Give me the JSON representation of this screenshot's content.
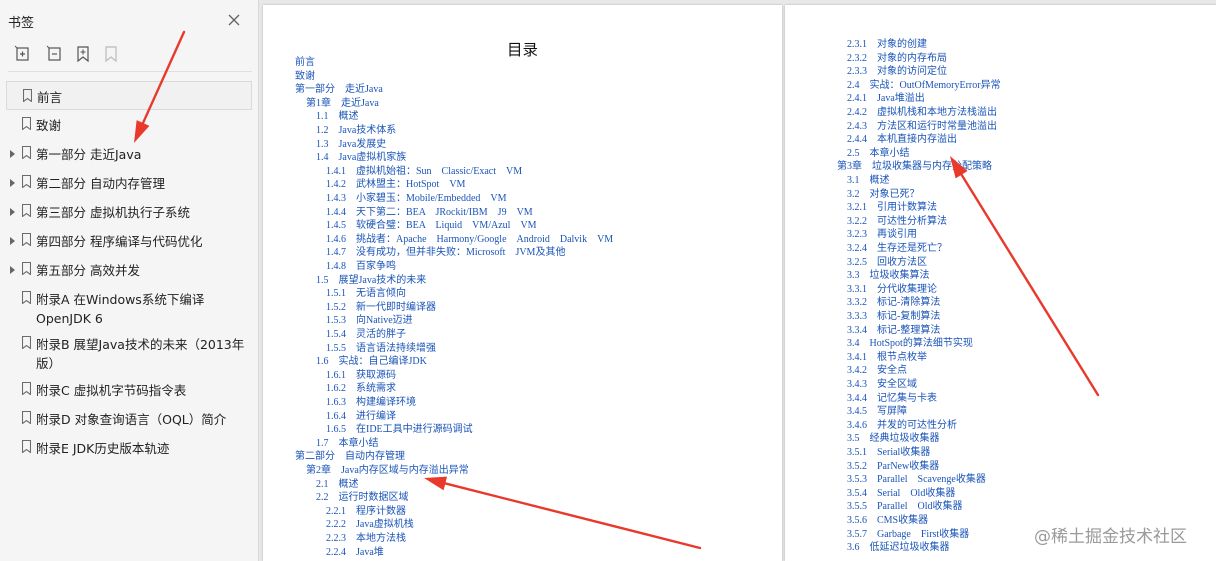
{
  "sidebar": {
    "title": "书签",
    "close_icon": "close-icon",
    "tools": [
      {
        "icon": "expand-bookmark-icon",
        "disabled": false
      },
      {
        "icon": "collapse-bookmark-icon",
        "disabled": false
      },
      {
        "icon": "add-bookmark-icon",
        "disabled": false
      },
      {
        "icon": "bookmark-flag-icon",
        "disabled": true
      }
    ],
    "items": [
      {
        "label": "前言",
        "expandable": false,
        "selected": true
      },
      {
        "label": "致谢",
        "expandable": false
      },
      {
        "label": "第一部分 走近Java",
        "expandable": true
      },
      {
        "label": "第二部分 自动内存管理",
        "expandable": true
      },
      {
        "label": "第三部分 虚拟机执行子系统",
        "expandable": true
      },
      {
        "label": "第四部分 程序编译与代码优化",
        "expandable": true
      },
      {
        "label": "第五部分 高效并发",
        "expandable": true
      },
      {
        "label": "附录A 在Windows系统下编译OpenJDK 6",
        "expandable": false,
        "lines": 2
      },
      {
        "label": "附录B 展望Java技术的未来（2013年版）",
        "expandable": false,
        "lines": 2
      },
      {
        "label": "附录C 虚拟机字节码指令表",
        "expandable": false
      },
      {
        "label": "附录D 对象查询语言（OQL）简介",
        "expandable": false
      },
      {
        "label": "附录E JDK历史版本轨迹",
        "expandable": false
      }
    ]
  },
  "page1": {
    "title": "目录",
    "entries": [
      {
        "text": "前言",
        "level": 0
      },
      {
        "text": "致谢",
        "level": 0
      },
      {
        "text": "第一部分　走近Java",
        "level": 0
      },
      {
        "text": "第1章　走近Java",
        "level": 1
      },
      {
        "text": "1.1　概述",
        "level": 2
      },
      {
        "text": "1.2　Java技术体系",
        "level": 2
      },
      {
        "text": "1.3　Java发展史",
        "level": 2
      },
      {
        "text": "1.4　Java虚拟机家族",
        "level": 2
      },
      {
        "text": "1.4.1　虚拟机始祖：Sun　Classic/Exact　VM",
        "level": 3
      },
      {
        "text": "1.4.2　武林盟主：HotSpot　VM",
        "level": 3
      },
      {
        "text": "1.4.3　小家碧玉：Mobile/Embedded　VM",
        "level": 3
      },
      {
        "text": "1.4.4　天下第二：BEA　JRockit/IBM　J9　VM",
        "level": 3
      },
      {
        "text": "1.4.5　软硬合璧：BEA　Liquid　VM/Azul　VM",
        "level": 3
      },
      {
        "text": "1.4.6　挑战者：Apache　Harmony/Google　Android　Dalvik　VM",
        "level": 3
      },
      {
        "text": "1.4.7　没有成功，但并非失败：Microsoft　JVM及其他",
        "level": 3
      },
      {
        "text": "1.4.8　百家争鸣",
        "level": 3
      },
      {
        "text": "1.5　展望Java技术的未来",
        "level": 2
      },
      {
        "text": "1.5.1　无语言倾向",
        "level": 3
      },
      {
        "text": "1.5.2　新一代即时编译器",
        "level": 3
      },
      {
        "text": "1.5.3　向Native迈进",
        "level": 3
      },
      {
        "text": "1.5.4　灵活的胖子",
        "level": 3
      },
      {
        "text": "1.5.5　语言语法持续增强",
        "level": 3
      },
      {
        "text": "1.6　实战：自己编译JDK",
        "level": 2
      },
      {
        "text": "1.6.1　获取源码",
        "level": 3
      },
      {
        "text": "1.6.2　系统需求",
        "level": 3
      },
      {
        "text": "1.6.3　构建编译环境",
        "level": 3
      },
      {
        "text": "1.6.4　进行编译",
        "level": 3
      },
      {
        "text": "1.6.5　在IDE工具中进行源码调试",
        "level": 3
      },
      {
        "text": "1.7　本章小结",
        "level": 2
      },
      {
        "text": "第二部分　自动内存管理",
        "level": 0
      },
      {
        "text": "第2章　Java内存区域与内存溢出异常",
        "level": 1
      },
      {
        "text": "2.1　概述",
        "level": 2
      },
      {
        "text": "2.2　运行时数据区域",
        "level": 2
      },
      {
        "text": "2.2.1　程序计数器",
        "level": 3
      },
      {
        "text": "2.2.2　Java虚拟机栈",
        "level": 3
      },
      {
        "text": "2.2.3　本地方法栈",
        "level": 3
      },
      {
        "text": "2.2.4　Java堆",
        "level": 3
      }
    ]
  },
  "page2": {
    "entries": [
      {
        "text": "2.3.1　对象的创建",
        "level": 3
      },
      {
        "text": "2.3.2　对象的内存布局",
        "level": 3
      },
      {
        "text": "2.3.3　对象的访问定位",
        "level": 3
      },
      {
        "text": "2.4　实战：OutOfMemoryError异常",
        "level": 2
      },
      {
        "text": "2.4.1　Java堆溢出",
        "level": 3
      },
      {
        "text": "2.4.2　虚拟机栈和本地方法栈溢出",
        "level": 3
      },
      {
        "text": "2.4.3　方法区和运行时常量池溢出",
        "level": 3
      },
      {
        "text": "2.4.4　本机直接内存溢出",
        "level": 3
      },
      {
        "text": "2.5　本章小结",
        "level": 2
      },
      {
        "text": "第3章　垃圾收集器与内存分配策略",
        "level": 1
      },
      {
        "text": "3.1　概述",
        "level": 2
      },
      {
        "text": "3.2　对象已死？",
        "level": 2
      },
      {
        "text": "3.2.1　引用计数算法",
        "level": 3
      },
      {
        "text": "3.2.2　可达性分析算法",
        "level": 3
      },
      {
        "text": "3.2.3　再谈引用",
        "level": 3
      },
      {
        "text": "3.2.4　生存还是死亡？",
        "level": 3
      },
      {
        "text": "3.2.5　回收方法区",
        "level": 3
      },
      {
        "text": "3.3　垃圾收集算法",
        "level": 2
      },
      {
        "text": "3.3.1　分代收集理论",
        "level": 3
      },
      {
        "text": "3.3.2　标记-清除算法",
        "level": 3
      },
      {
        "text": "3.3.3　标记-复制算法",
        "level": 3
      },
      {
        "text": "3.3.4　标记-整理算法",
        "level": 3
      },
      {
        "text": "3.4　HotSpot的算法细节实现",
        "level": 2
      },
      {
        "text": "3.4.1　根节点枚举",
        "level": 3
      },
      {
        "text": "3.4.2　安全点",
        "level": 3
      },
      {
        "text": "3.4.3　安全区域",
        "level": 3
      },
      {
        "text": "3.4.4　记忆集与卡表",
        "level": 3
      },
      {
        "text": "3.4.5　写屏障",
        "level": 3
      },
      {
        "text": "3.4.6　并发的可达性分析",
        "level": 3
      },
      {
        "text": "3.5　经典垃圾收集器",
        "level": 2
      },
      {
        "text": "3.5.1　Serial收集器",
        "level": 3
      },
      {
        "text": "3.5.2　ParNew收集器",
        "level": 3
      },
      {
        "text": "3.5.3　Parallel　Scavenge收集器",
        "level": 3
      },
      {
        "text": "3.5.4　Serial　Old收集器",
        "level": 3
      },
      {
        "text": "3.5.5　Parallel　Old收集器",
        "level": 3
      },
      {
        "text": "3.5.6　CMS收集器",
        "level": 3
      },
      {
        "text": "3.5.7　Garbage　First收集器",
        "level": 3
      },
      {
        "text": "3.6　低延迟垃圾收集器",
        "level": 2
      }
    ]
  },
  "annotation_color": "#e8392b",
  "watermark": "@稀土掘金技术社区"
}
